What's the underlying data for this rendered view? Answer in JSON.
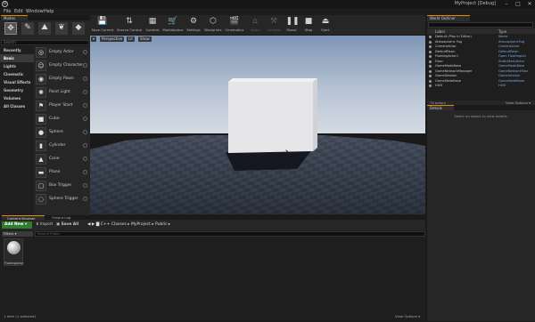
{
  "window": {
    "title": "MyProject [Debug]",
    "minimize": "–",
    "maximize": "□",
    "close": "✕",
    "logo": "U"
  },
  "menu": [
    "File",
    "Edit",
    "Window",
    "Help"
  ],
  "modes": {
    "tab": "Modes",
    "search_placeholder": "Search",
    "tools": [
      {
        "icon": "place-mode-icon",
        "glyph": "✥"
      },
      {
        "icon": "paint-mode-icon",
        "glyph": "✎"
      },
      {
        "icon": "landscape-mode-icon",
        "glyph": "⛰"
      },
      {
        "icon": "foliage-mode-icon",
        "glyph": "❦"
      },
      {
        "icon": "geometry-mode-icon",
        "glyph": "◆"
      }
    ],
    "categories": [
      "Recently Placed",
      "Basic",
      "Lights",
      "Cinematic",
      "Visual Effects",
      "Geometry",
      "Volumes",
      "All Classes"
    ],
    "selected_category": "Basic",
    "items": [
      {
        "label": "Empty Actor",
        "glyph": "◎"
      },
      {
        "label": "Empty Character",
        "glyph": "☺"
      },
      {
        "label": "Empty Pawn",
        "glyph": "◉"
      },
      {
        "label": "Point Light",
        "glyph": "✺"
      },
      {
        "label": "Player Start",
        "glyph": "⚑"
      },
      {
        "label": "Cube",
        "glyph": "■"
      },
      {
        "label": "Sphere",
        "glyph": "●"
      },
      {
        "label": "Cylinder",
        "glyph": "▮"
      },
      {
        "label": "Cone",
        "glyph": "▲"
      },
      {
        "label": "Plane",
        "glyph": "▬"
      },
      {
        "label": "Box Trigger",
        "glyph": "▢"
      },
      {
        "label": "Sphere Trigger",
        "glyph": "◌"
      }
    ]
  },
  "toolbar": [
    {
      "label": "Save Current",
      "glyph": "💾",
      "icon": "save-icon",
      "disabled": false
    },
    {
      "label": "Source Control",
      "glyph": "⇅",
      "icon": "source-control-icon",
      "disabled": false
    },
    {
      "label": "Content",
      "glyph": "▦",
      "icon": "content-icon",
      "disabled": false
    },
    {
      "label": "Marketplace",
      "glyph": "🛒",
      "icon": "marketplace-icon",
      "disabled": false
    },
    {
      "label": "Settings",
      "glyph": "⚙",
      "icon": "settings-icon",
      "disabled": false
    },
    {
      "label": "Blueprints",
      "glyph": "⬡",
      "icon": "blueprints-icon",
      "disabled": false
    },
    {
      "label": "Cinematics",
      "glyph": "🎬",
      "icon": "cinematics-icon",
      "disabled": false
    },
    {
      "label": "Build",
      "glyph": "⌂",
      "icon": "build-icon",
      "disabled": true
    },
    {
      "label": "Compile",
      "glyph": "⚒",
      "icon": "compile-icon",
      "disabled": true
    },
    {
      "label": "Pause",
      "glyph": "❚❚",
      "icon": "pause-icon",
      "disabled": false
    },
    {
      "label": "Stop",
      "glyph": "■",
      "icon": "stop-icon",
      "disabled": false
    },
    {
      "label": "Eject",
      "glyph": "⏏",
      "icon": "eject-icon",
      "disabled": false
    }
  ],
  "viewport": {
    "chips": [
      "▾",
      "Perspective",
      "Lit",
      "Show"
    ]
  },
  "outliner": {
    "tab": "World Outliner",
    "col_label": "Label",
    "col_type": "Type",
    "rows": [
      {
        "name": "Default (Play In Editor)",
        "type": "World"
      },
      {
        "name": "Atmospheric Fog",
        "type": "AtmosphericFog"
      },
      {
        "name": "CameraActor",
        "type": "CameraActor"
      },
      {
        "name": "DefaultPawn",
        "type": "DefaultPawn"
      },
      {
        "name": "FloatingActor1",
        "type": "Open FloatingAct"
      },
      {
        "name": "Floor",
        "type": "StaticMeshActor"
      },
      {
        "name": "GameModeBase",
        "type": "GameModeBase"
      },
      {
        "name": "GameNetworkManager",
        "type": "GameNetworkMan"
      },
      {
        "name": "GameSession",
        "type": "GameSession"
      },
      {
        "name": "GameStateBase",
        "type": "GameStateBase"
      },
      {
        "name": "HUD",
        "type": "HUD"
      }
    ],
    "footer_count": "74 actors",
    "footer_view": "View Options ▾"
  },
  "details": {
    "tab": "Details",
    "empty_message": "Select an object to view details."
  },
  "content_browser": {
    "tabs": [
      "Content Browser",
      "Output Log"
    ],
    "add_new": "Add New ▾",
    "import": "Import",
    "save_all": "Save All",
    "path": [
      "C++ Classes",
      "MyProject",
      "Public"
    ],
    "filters": "Filters ▾",
    "search_placeholder": "Search Public",
    "asset_name": "FloatingActor",
    "status": "1 item (1 selected)",
    "view_options": "View Options ▾"
  },
  "colors": {
    "accent": "#e28a00",
    "add_new_green": "#2f7d2f",
    "type_blue": "#7fa8d8"
  }
}
